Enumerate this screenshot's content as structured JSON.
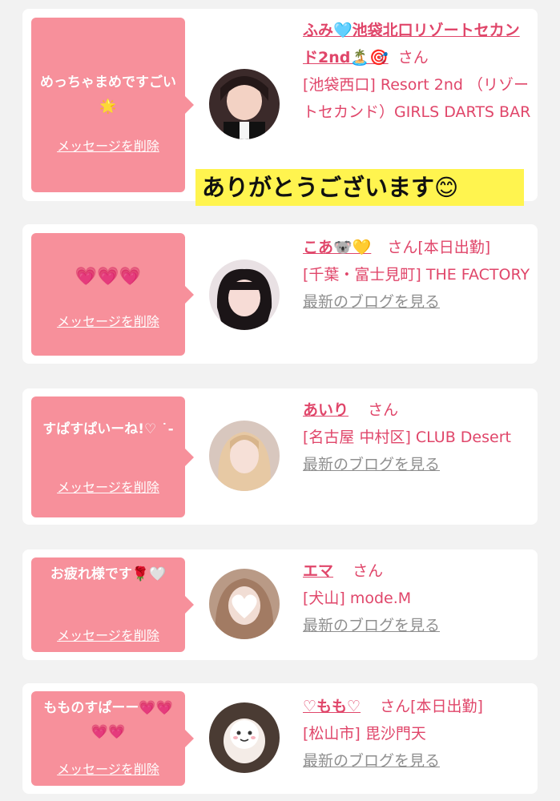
{
  "messages": [
    {
      "message": "めっちゃまめですごい🌟",
      "delete_label": "メッセージを削除",
      "name": "ふみ🩵池袋北口リゾートセカンド2nd🏝️🎯",
      "honorific": "さん",
      "tag": "",
      "shop": "[池袋西口] Resort 2nd （リゾートセカンド）GIRLS DARTS BAR",
      "blog_label": ""
    },
    {
      "message": "💗💗💗",
      "delete_label": "メッセージを削除",
      "name": "こあ🐨💛",
      "honorific": "さん",
      "tag": "[本日出勤]",
      "shop": "[千葉・富士見町] THE FACTORY",
      "blog_label": "最新のブログを見る"
    },
    {
      "message": "すぱすぱいーね!♡ ˙-",
      "delete_label": "メッセージを削除",
      "name": "あいり",
      "honorific": "さん",
      "tag": "",
      "shop": "[名古屋 中村区] CLUB Desert",
      "blog_label": "最新のブログを見る"
    },
    {
      "message": "お疲れ様です🌹🤍",
      "delete_label": "メッセージを削除",
      "name": "エマ",
      "honorific": "さん",
      "tag": "",
      "shop": "[犬山] mode.M",
      "blog_label": "最新のブログを見る"
    },
    {
      "message": "もものすぱーー💗💗💗💗",
      "delete_label": "メッセージを削除",
      "name": "♡もも♡",
      "honorific": "さん",
      "tag": "[本日出勤]",
      "shop": "[松山市] 毘沙門天",
      "blog_label": "最新のブログを見る"
    }
  ],
  "reply_banner": "ありがとうございます😊",
  "colors": {
    "bubble": "#f7909b",
    "accent": "#e0466a",
    "highlight": "#fff44f",
    "muted": "#8f8f8f"
  }
}
